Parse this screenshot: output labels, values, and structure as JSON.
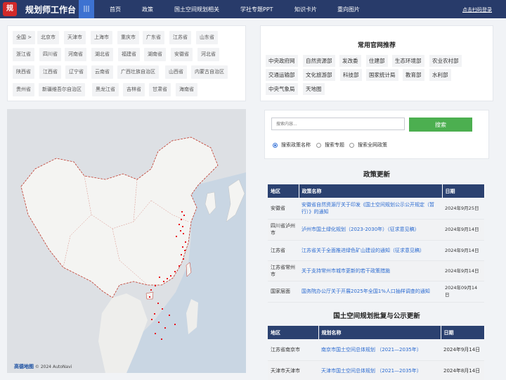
{
  "header": {
    "logo_glyph": "规",
    "title": "规划师工作台",
    "menu_icon": "|||",
    "nav": [
      "首页",
      "政策",
      "国土空间规划相关",
      "学社专题PPT",
      "知识卡片",
      "重向图片"
    ],
    "login": "点击扫码登录"
  },
  "regions": {
    "rows": [
      [
        "全国 >",
        "北京市",
        "天津市",
        "上海市",
        "重庆市",
        "广东省",
        "江苏省",
        "山东省"
      ],
      [
        "浙江省",
        "四川省",
        "河南省",
        "湖北省",
        "福建省",
        "湖南省",
        "安徽省",
        "河北省"
      ],
      [
        "陕西省",
        "江西省",
        "辽宁省",
        "云南省",
        "广西壮族自治区",
        "山西省",
        "内蒙古自治区"
      ],
      [
        "贵州省",
        "新疆维吾尔自治区",
        "黑龙江省",
        "吉林省",
        "甘肃省",
        "海南省"
      ]
    ]
  },
  "map": {
    "provider": "高德地图",
    "copyright": "© 2024 AutoNavi",
    "marker_color": "#e8141b",
    "border_color": "#c0392b"
  },
  "official_sites": {
    "title": "常用官网推荐",
    "items": [
      "中央政府网",
      "自然资源部",
      "发改委",
      "住建部",
      "生态环境部",
      "农业农村部",
      "交通运输部",
      "文化旅游部",
      "科技部",
      "国家统计局",
      "教育部",
      "水利部",
      "中央气象局",
      "天地图"
    ]
  },
  "search": {
    "placeholder": "搜索内容...",
    "button": "搜索",
    "options": [
      "搜索政策名称",
      "搜索专题",
      "搜索全网政策"
    ],
    "selected": "搜索政策名称"
  },
  "policy_updates": {
    "title": "政策更新",
    "headers": [
      "地区",
      "政策名称",
      "日期"
    ],
    "rows": [
      [
        "安徽省",
        "安徽省自然资源厅关于印发《国土空间规划公示公开规定（暂行）》的通知",
        "2024年9月25日"
      ],
      [
        "四川省泸州市",
        "泸州市国土绿化规划（2023-2030年）（征求意见稿）",
        "2024年9月14日"
      ],
      [
        "江苏省",
        "江苏省关于全面推进绿色矿山建设的通知（征求意见稿）",
        "2024年9月14日"
      ],
      [
        "江苏省常州市",
        "关于支持常州市城市更新的若干政策措施",
        "2024年9月14日"
      ],
      [
        "国家层面",
        "国务院办公厅关于开展2025年全国1%人口抽样调查的通知",
        "2024年09月14日"
      ]
    ]
  },
  "plan_updates": {
    "title": "国土空间规划批复与公示更新",
    "headers": [
      "地区",
      "规划名称",
      "日期"
    ],
    "rows": [
      [
        "江苏省南京市",
        "南京市国土空间总体规划 （2021—2035年）",
        "2024年9月14日"
      ],
      [
        "天津市天津市",
        "天津市国土空间总体规划 （2021—2035年）",
        "2024年8月14日"
      ]
    ]
  },
  "colors": {
    "header_bg": "#283b6a",
    "accent": "#3d72d1",
    "search_button": "#4caf50",
    "link": "#2a6ad0",
    "table_header": "#2b4170"
  }
}
